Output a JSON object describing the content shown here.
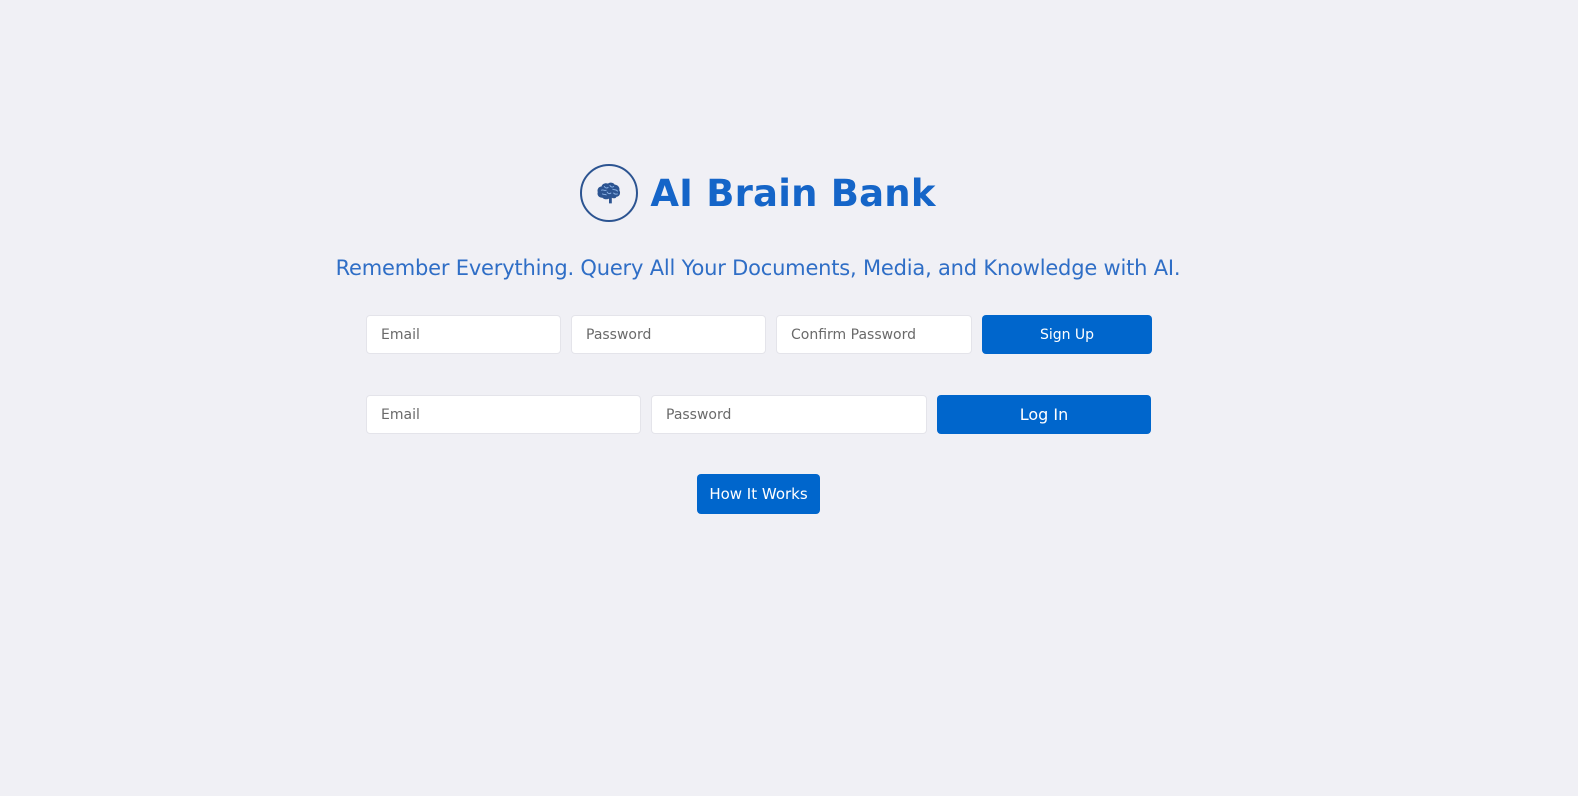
{
  "header": {
    "title": "AI Brain Bank",
    "logo_icon": "brain-icon"
  },
  "tagline": "Remember Everything. Query All Your Documents, Media, and Knowledge with AI.",
  "signup": {
    "email_placeholder": "Email",
    "password_placeholder": "Password",
    "confirm_placeholder": "Confirm Password",
    "button_label": "Sign Up"
  },
  "login": {
    "email_placeholder": "Email",
    "password_placeholder": "Password",
    "button_label": "Log In"
  },
  "how_it_works": {
    "button_label": "How It Works"
  },
  "colors": {
    "background": "#f0f0f5",
    "primary": "#0066cc",
    "title": "#1565c8",
    "logo_stroke": "#2c5491"
  }
}
